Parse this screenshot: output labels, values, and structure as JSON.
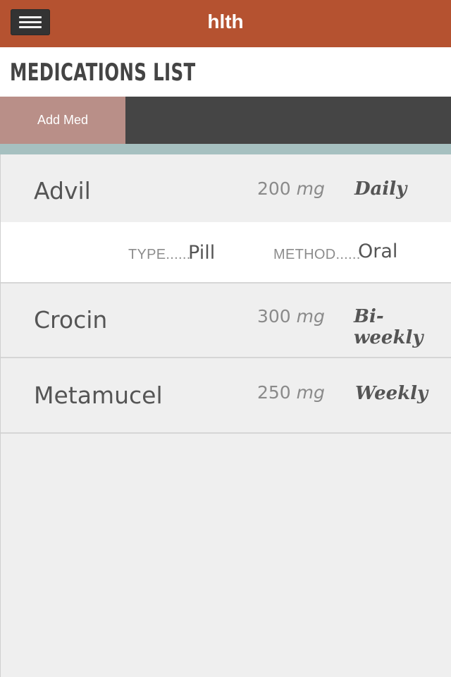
{
  "app": {
    "title": "hlth"
  },
  "page": {
    "title": "MEDICATIONS LIST"
  },
  "actions": {
    "add_med_label": "Add Med"
  },
  "medications": [
    {
      "name": "Advil",
      "dose": "200",
      "unit": "mg",
      "frequency": "Daily",
      "expanded": true,
      "type_label": "TYPE......",
      "type": "Pill",
      "method_label": "METHOD......",
      "method": "Oral"
    },
    {
      "name": "Crocin",
      "dose": "300",
      "unit": "mg",
      "frequency": "Bi-weekly"
    },
    {
      "name": "Metamucel",
      "dose": "250",
      "unit": "mg",
      "frequency": "Weekly"
    }
  ],
  "colors": {
    "header": "#b55230",
    "add_button": "#b98f88",
    "action_bar": "#454545",
    "accent_strip": "#a6c0c0",
    "list_background": "#efefef"
  },
  "icons": {
    "menu": "hamburger-menu-icon"
  }
}
